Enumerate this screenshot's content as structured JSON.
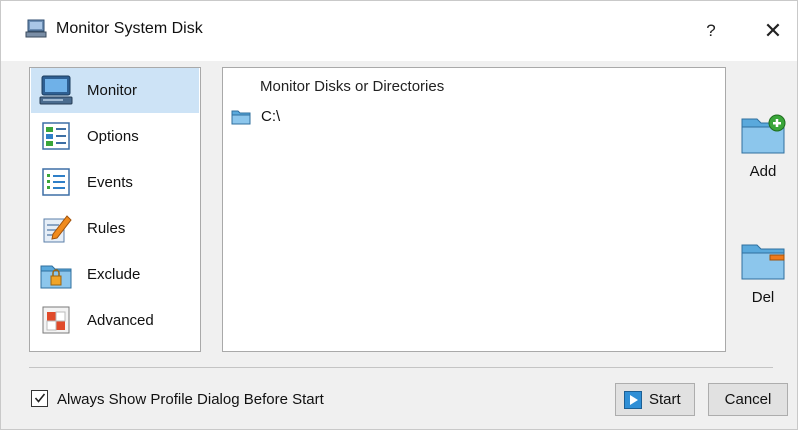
{
  "window": {
    "title": "Monitor System Disk",
    "help_label": "?",
    "close_label": "✕"
  },
  "nav": {
    "items": [
      {
        "label": "Monitor",
        "icon": "monitor-icon",
        "selected": true
      },
      {
        "label": "Options",
        "icon": "options-icon",
        "selected": false
      },
      {
        "label": "Events",
        "icon": "events-icon",
        "selected": false
      },
      {
        "label": "Rules",
        "icon": "rules-icon",
        "selected": false
      },
      {
        "label": "Exclude",
        "icon": "exclude-icon",
        "selected": false
      },
      {
        "label": "Advanced",
        "icon": "advanced-icon",
        "selected": false
      }
    ]
  },
  "list": {
    "header": "Monitor Disks or Directories",
    "rows": [
      {
        "text": "C:\\",
        "icon": "folder-icon"
      }
    ]
  },
  "side_buttons": {
    "add_label": "Add",
    "del_label": "Del"
  },
  "footer": {
    "checkbox_label": "Always Show Profile Dialog Before Start",
    "checkbox_checked": true,
    "start_label": "Start",
    "cancel_label": "Cancel"
  },
  "colors": {
    "selected_bg": "#cde3f6",
    "folder_blue": "#5aa9dc",
    "add_green": "#3aa63a",
    "del_orange": "#f07a1a"
  }
}
